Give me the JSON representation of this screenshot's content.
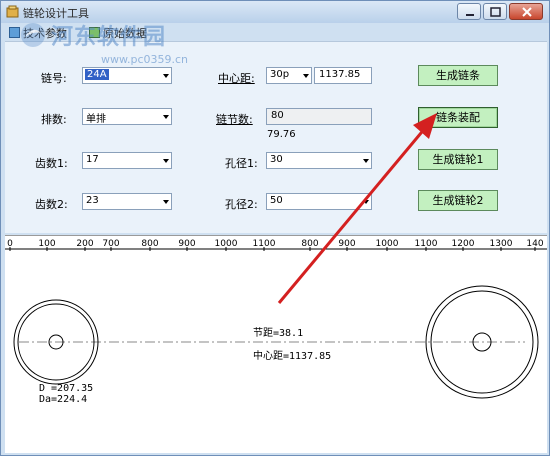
{
  "window": {
    "title": "链轮设计工具"
  },
  "toolbar": {
    "items": [
      {
        "label": "技术参数",
        "icon": "settings-icon"
      },
      {
        "label": "原始数据",
        "icon": "data-icon"
      }
    ]
  },
  "watermark": {
    "title": "河东软件园",
    "url": "www.pc0359.cn"
  },
  "form": {
    "chain_no_label": "链号:",
    "chain_no_value": "24A",
    "rows_label": "排数:",
    "rows_value": "单排",
    "teeth1_label": "齿数1:",
    "teeth1_value": "17",
    "teeth2_label": "齿数2:",
    "teeth2_value": "23",
    "center_label": "中心距:",
    "center_unit": "30p",
    "center_value": "1137.85",
    "links_label": "链节数:",
    "links_value": "80",
    "links_note": "79.76",
    "bore1_label": "孔径1:",
    "bore1_value": "30",
    "bore2_label": "孔径2:",
    "bore2_value": "50"
  },
  "buttons": {
    "gen_chain": "生成链条",
    "chain_assembly": "链条装配",
    "gen_sprocket1": "生成链轮1",
    "gen_sprocket2": "生成链轮2"
  },
  "ruler": {
    "ticks": [
      "0",
      "100",
      "200",
      "700",
      "800",
      "900",
      "1000",
      "1100",
      "800",
      "900",
      "1000",
      "1100",
      "1200",
      "1300",
      "140"
    ]
  },
  "drawing": {
    "pitch": "节距=38.1",
    "center_distance": "中心距=1137.85",
    "d_label": "D =207.35",
    "da_label": "Da=224.4"
  },
  "colors": {
    "accent_red": "#d42020",
    "button_green": "#c3f0c0",
    "panel_bg": "#eaf2fa"
  }
}
